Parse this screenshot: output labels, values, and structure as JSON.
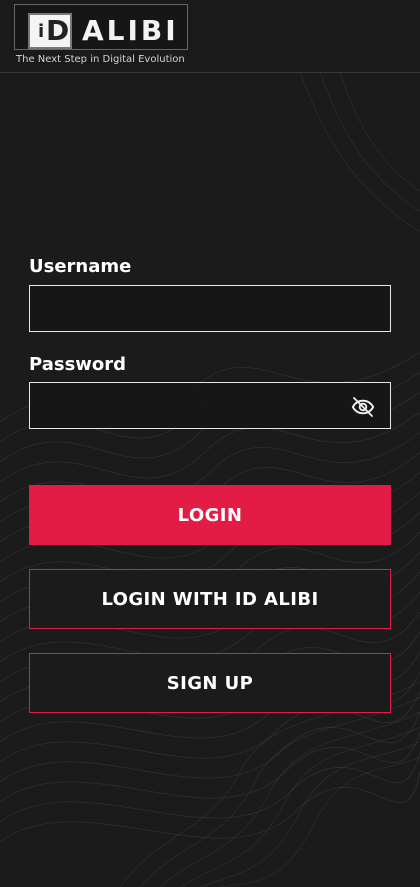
{
  "brand": {
    "logo_word": "ALIBI",
    "logo_mark": "iD",
    "tagline": "The Next Step in Digital Evolution"
  },
  "form": {
    "username_label": "Username",
    "username_value": "",
    "password_label": "Password",
    "password_value": "",
    "password_visibility_icon": "eye-slash-icon"
  },
  "buttons": {
    "login": "LOGIN",
    "login_with_id_alibi": "LOGIN WITH ID ALIBI",
    "sign_up": "SIGN UP"
  },
  "colors": {
    "background": "#1b1b1c",
    "accent": "#e31c45",
    "text": "#ffffff"
  }
}
